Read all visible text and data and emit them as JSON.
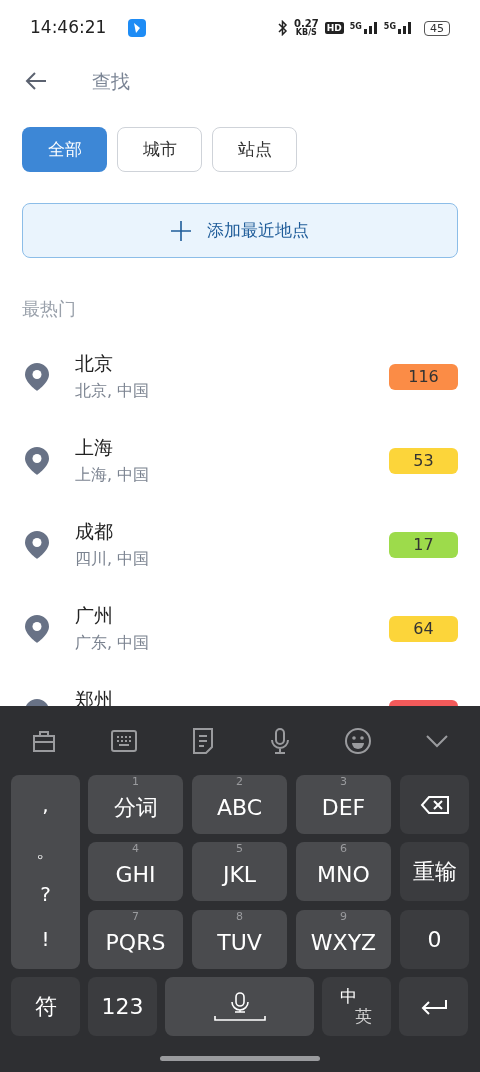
{
  "status_bar": {
    "time": "14:46:21",
    "net_speed": "0.27",
    "net_unit": "KB/S",
    "hd": "HD",
    "signal_1": "5G",
    "signal_2": "5G",
    "battery": "45"
  },
  "header": {
    "title": "查找"
  },
  "filters": [
    {
      "label": "全部",
      "selected": true
    },
    {
      "label": "城市",
      "selected": false
    },
    {
      "label": "站点",
      "selected": false
    }
  ],
  "add_button": {
    "label": "添加最近地点"
  },
  "section_title": "最热门",
  "places": [
    {
      "name": "北京",
      "region": "北京, 中国",
      "aqi": "116",
      "color": "#fb8c46"
    },
    {
      "name": "上海",
      "region": "上海, 中国",
      "aqi": "53",
      "color": "#fcd53a"
    },
    {
      "name": "成都",
      "region": "四川, 中国",
      "aqi": "17",
      "color": "#9ddb4b"
    },
    {
      "name": "广州",
      "region": "广东, 中国",
      "aqi": "64",
      "color": "#fcd53a"
    },
    {
      "name": "郑州",
      "color": "#f25a5a"
    }
  ],
  "keyboard": {
    "punctuation": [
      ",",
      "。",
      "?",
      "!"
    ],
    "keys": [
      {
        "kind": "letter",
        "digit": "1",
        "label": "分词"
      },
      {
        "kind": "letter",
        "digit": "2",
        "label": "ABC"
      },
      {
        "kind": "letter",
        "digit": "3",
        "label": "DEF"
      },
      {
        "kind": "backspace"
      },
      {
        "kind": "letter",
        "digit": "4",
        "label": "GHI"
      },
      {
        "kind": "letter",
        "digit": "5",
        "label": "JKL"
      },
      {
        "kind": "letter",
        "digit": "6",
        "label": "MNO"
      },
      {
        "kind": "function",
        "label": "重输"
      },
      {
        "kind": "letter",
        "digit": "7",
        "label": "PQRS"
      },
      {
        "kind": "letter",
        "digit": "8",
        "label": "TUV"
      },
      {
        "kind": "letter",
        "digit": "9",
        "label": "WXYZ"
      },
      {
        "kind": "function",
        "label": "0"
      }
    ],
    "bottom_row": [
      {
        "kind": "function",
        "label": "符"
      },
      {
        "kind": "function",
        "label": "123"
      },
      {
        "kind": "space"
      },
      {
        "kind": "lang",
        "label": "中",
        "label_2": "英"
      },
      {
        "kind": "enter"
      }
    ]
  }
}
